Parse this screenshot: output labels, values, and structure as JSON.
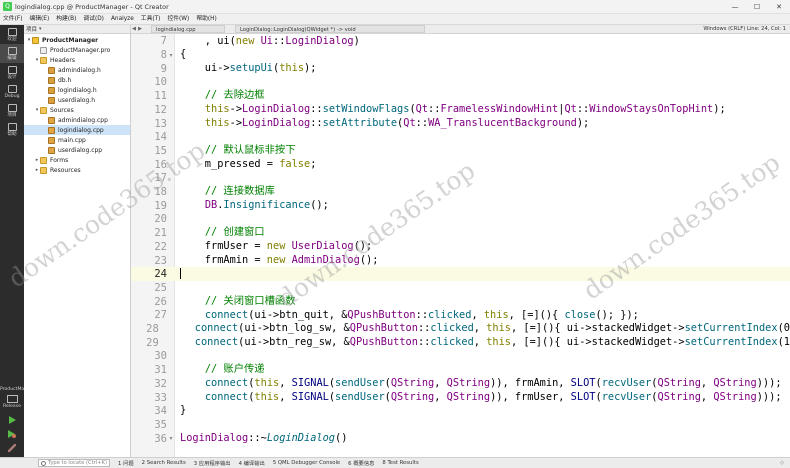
{
  "window": {
    "title": "logindialog.cpp @ ProductManager - Qt Creator",
    "controls": [
      "—",
      "☐",
      "✕"
    ]
  },
  "menu": [
    "文件(F)",
    "编辑(E)",
    "构建(B)",
    "调试(D)",
    "Analyze",
    "工具(T)",
    "控件(W)",
    "帮助(H)"
  ],
  "modes": [
    {
      "label": "欢迎",
      "icon": "welcome-icon"
    },
    {
      "label": "编辑",
      "icon": "edit-icon",
      "active": true
    },
    {
      "label": "设计",
      "icon": "design-icon"
    },
    {
      "label": "Debug",
      "icon": "debug-icon"
    },
    {
      "label": "项目",
      "icon": "projects-icon"
    },
    {
      "label": "帮助",
      "icon": "help-icon"
    }
  ],
  "mode_lower": {
    "target": "ProductManager",
    "build": "Release"
  },
  "sidebar": {
    "header": "项目",
    "tree": [
      {
        "label": "ProductManager",
        "depth": 0,
        "toggle": "▾",
        "icon": "proj",
        "bold": true
      },
      {
        "label": "ProductManager.pro",
        "depth": 1,
        "toggle": "",
        "icon": "file-pro"
      },
      {
        "label": "Headers",
        "depth": 1,
        "toggle": "▾",
        "icon": "folder"
      },
      {
        "label": "admindialog.h",
        "depth": 2,
        "toggle": "",
        "icon": "file-h"
      },
      {
        "label": "db.h",
        "depth": 2,
        "toggle": "",
        "icon": "file-h"
      },
      {
        "label": "logindialog.h",
        "depth": 2,
        "toggle": "",
        "icon": "file-h"
      },
      {
        "label": "userdialog.h",
        "depth": 2,
        "toggle": "",
        "icon": "file-h"
      },
      {
        "label": "Sources",
        "depth": 1,
        "toggle": "▾",
        "icon": "folder"
      },
      {
        "label": "admindialog.cpp",
        "depth": 2,
        "toggle": "",
        "icon": "file-cpp"
      },
      {
        "label": "logindialog.cpp",
        "depth": 2,
        "toggle": "",
        "icon": "file-cpp",
        "selected": true
      },
      {
        "label": "main.cpp",
        "depth": 2,
        "toggle": "",
        "icon": "file-cpp"
      },
      {
        "label": "userdialog.cpp",
        "depth": 2,
        "toggle": "",
        "icon": "file-cpp"
      },
      {
        "label": "Forms",
        "depth": 1,
        "toggle": "▸",
        "icon": "folder"
      },
      {
        "label": "Resources",
        "depth": 1,
        "toggle": "▸",
        "icon": "folder"
      }
    ]
  },
  "editor_toolbar": {
    "document": "logindialog.cpp",
    "symbol": "LoginDialog::LoginDialog(QWidget *) -> void",
    "right": "Windows (CRLF)   Line: 24, Col: 1"
  },
  "current_line": 24,
  "code_lines": [
    {
      "n": 7,
      "fold": "",
      "html": "    , ui(<span class=\"kw\">new</span> <span class=\"cls\">Ui</span>::<span class=\"cls\">LoginDialog</span>)"
    },
    {
      "n": 8,
      "fold": "▾",
      "html": "{"
    },
    {
      "n": 9,
      "fold": "",
      "html": "    ui-><span class=\"fn\">setupUi</span>(<span class=\"kw\">this</span>);"
    },
    {
      "n": 10,
      "fold": "",
      "html": ""
    },
    {
      "n": 11,
      "fold": "",
      "html": "    <span class=\"cm\">// 去除边框</span>"
    },
    {
      "n": 12,
      "fold": "",
      "html": "    <span class=\"kw\">this</span>-><span class=\"cls\">LoginDialog</span>::<span class=\"fn\">setWindowFlags</span>(<span class=\"cls\">Qt</span>::<span class=\"cls\">FramelessWindowHint</span>|<span class=\"cls\">Qt</span>::<span class=\"cls\">WindowStaysOnTopHint</span>);"
    },
    {
      "n": 13,
      "fold": "",
      "html": "    <span class=\"kw\">this</span>-><span class=\"cls\">LoginDialog</span>::<span class=\"fn\">setAttribute</span>(<span class=\"cls\">Qt</span>::<span class=\"cls\">WA_TranslucentBackground</span>);"
    },
    {
      "n": 14,
      "fold": "",
      "html": ""
    },
    {
      "n": 15,
      "fold": "",
      "html": "    <span class=\"cm\">// 默认鼠标非按下</span>"
    },
    {
      "n": 16,
      "fold": "",
      "html": "    m_pressed = <span class=\"kw\">false</span>;"
    },
    {
      "n": 17,
      "fold": "",
      "html": ""
    },
    {
      "n": 18,
      "fold": "",
      "html": "    <span class=\"cm\">// 连接数据库</span>"
    },
    {
      "n": 19,
      "fold": "",
      "html": "    <span class=\"cls\">DB</span>.<span class=\"fn\">Insignificance</span>();"
    },
    {
      "n": 20,
      "fold": "",
      "html": ""
    },
    {
      "n": 21,
      "fold": "",
      "html": "    <span class=\"cm\">// 创建窗口</span>"
    },
    {
      "n": 22,
      "fold": "",
      "html": "    frmUser = <span class=\"kw\">new</span> <span class=\"cls\">UserDialog</span>();"
    },
    {
      "n": 23,
      "fold": "",
      "html": "    frmAmin = <span class=\"kw\">new</span> <span class=\"cls\">AdminDialog</span>();"
    },
    {
      "n": 24,
      "fold": "",
      "html": "<span class=\"cursor\"></span>"
    },
    {
      "n": 25,
      "fold": "",
      "html": ""
    },
    {
      "n": 26,
      "fold": "",
      "html": "    <span class=\"cm\">// 关闭窗口槽函数</span>"
    },
    {
      "n": 27,
      "fold": "",
      "html": "    <span class=\"fn\">connect</span>(ui->btn_quit, &<span class=\"cls\">QPushButton</span>::<span class=\"fn\">clicked</span>, <span class=\"kw\">this</span>, [=](){ <span class=\"fn\">close</span>(); });"
    },
    {
      "n": 28,
      "fold": "",
      "html": "    <span class=\"fn\">connect</span>(ui->btn_log_sw, &<span class=\"cls\">QPushButton</span>::<span class=\"fn\">clicked</span>, <span class=\"kw\">this</span>, [=](){ ui->stackedWidget-><span class=\"fn\">setCurrentIndex</span>(0"
    },
    {
      "n": 29,
      "fold": "",
      "html": "    <span class=\"fn\">connect</span>(ui->btn_reg_sw, &<span class=\"cls\">QPushButton</span>::<span class=\"fn\">clicked</span>, <span class=\"kw\">this</span>, [=](){ ui->stackedWidget-><span class=\"fn\">setCurrentIndex</span>(1"
    },
    {
      "n": 30,
      "fold": "",
      "html": ""
    },
    {
      "n": 31,
      "fold": "",
      "html": "    <span class=\"cm\">// 账户传递</span>"
    },
    {
      "n": 32,
      "fold": "",
      "html": "    <span class=\"fn\">connect</span>(<span class=\"kw\">this</span>, <span class=\"mac\">SIGNAL</span>(<span class=\"fn\">sendUser</span>(<span class=\"cls\">QString</span>, <span class=\"cls\">QString</span>)), frmAmin, <span class=\"mac\">SLOT</span>(<span class=\"fn\">recvUser</span>(<span class=\"cls\">QString</span>, <span class=\"cls\">QString</span>)));"
    },
    {
      "n": 33,
      "fold": "",
      "html": "    <span class=\"fn\">connect</span>(<span class=\"kw\">this</span>, <span class=\"mac\">SIGNAL</span>(<span class=\"fn\">sendUser</span>(<span class=\"cls\">QString</span>, <span class=\"cls\">QString</span>)), frmUser, <span class=\"mac\">SLOT</span>(<span class=\"fn\">recvUser</span>(<span class=\"cls\">QString</span>, <span class=\"cls\">QString</span>)));"
    },
    {
      "n": 34,
      "fold": "",
      "html": "}"
    },
    {
      "n": 35,
      "fold": "",
      "html": ""
    },
    {
      "n": 36,
      "fold": "▾",
      "html": "<span class=\"cls\">LoginDialog</span>::~<span class=\"it\">LoginDialog</span>()"
    }
  ],
  "watermarks": [
    "down.code365.top",
    "down.code365.top",
    "down.code365.top"
  ],
  "statusbar": {
    "locator_placeholder": "Type to locate (Ctrl+K)",
    "tabs": [
      "1 问题",
      "2 Search Results",
      "3 应用程序输出",
      "4 编译输出",
      "5 QML Debugger Console",
      "6 概要信息",
      "8 Test Results"
    ],
    "right": "◇"
  }
}
